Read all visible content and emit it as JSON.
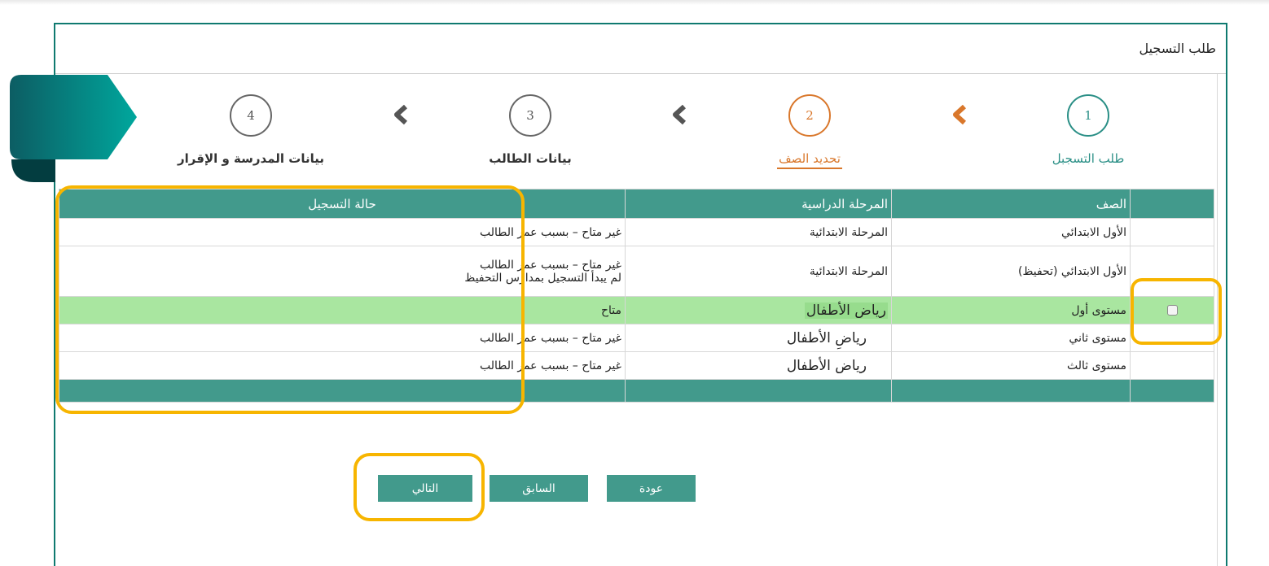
{
  "panel": {
    "title": "طلب التسجيل"
  },
  "steps": [
    {
      "number": "1",
      "label": "طلب التسجبل",
      "state": "done"
    },
    {
      "number": "2",
      "label": "تحديد الصف",
      "state": "active"
    },
    {
      "number": "3",
      "label": "بيانات الطالب",
      "state": "pending"
    },
    {
      "number": "4",
      "label": "بيانات المدرسة و الإقرار",
      "state": "pending"
    }
  ],
  "table": {
    "headers": {
      "grade": "الصف",
      "stage": "المرحلة الدراسية",
      "status": "حالة التسجيل"
    },
    "rows": [
      {
        "grade": "الأول الابتدائي",
        "stage": "المرحلة الابتدائية",
        "status": "غير متاح – بسبب عمر الطالب",
        "status2": ""
      },
      {
        "grade": "الأول الابتدائي (تحفيظ)",
        "stage": "المرحلة الابتدائية",
        "status": "غير متاح – بسبب عمر الطالب",
        "status2": "لم يبدأ التسجيل بمدارس التحفيظ"
      },
      {
        "grade": "مستوى أول",
        "stage": "رياض الأطفال",
        "status": "متاح",
        "status2": ""
      },
      {
        "grade": "مستوى ثاني",
        "stage": "رياضِ الأطفال",
        "status": "غير متاح – بسبب عمر الطالب",
        "status2": ""
      },
      {
        "grade": "مستوى ثالث",
        "stage": "رياض الأطفال",
        "status": "غير متاح – بسبب عمر الطالب",
        "status2": ""
      }
    ]
  },
  "buttons": {
    "next": "التالي",
    "previous": "السابق",
    "back": "عودة"
  },
  "colors": {
    "teal": "#429a8c",
    "border": "#0f7a70",
    "active": "#d9772b",
    "available": "#a9e6a0",
    "highlight": "#f7b500"
  }
}
